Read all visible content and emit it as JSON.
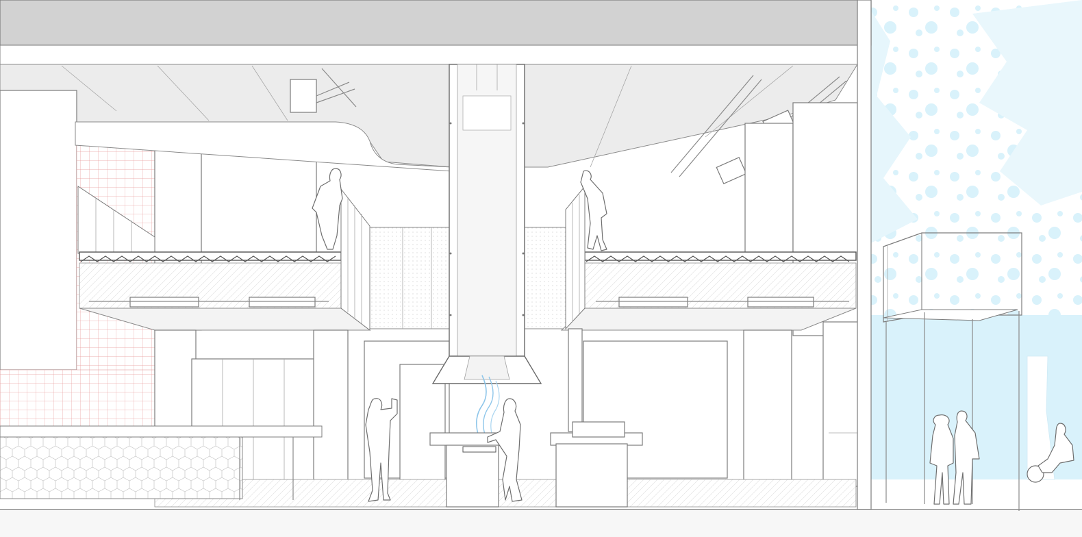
{
  "drawing": {
    "type": "architectural-section-perspective",
    "colors": {
      "background": "#ffffff",
      "roof_slab": "#d2d2d2",
      "ceiling": "#ececec",
      "linework": "#8a8a8a",
      "grid_tile_accent": "#e99a9a",
      "exterior_sky": "#d9f2fb",
      "exhaust_smoke": "#8ec6ea"
    },
    "elements": [
      {
        "name": "roof-slab"
      },
      {
        "name": "ceiling-beams"
      },
      {
        "name": "left-mezzanine"
      },
      {
        "name": "right-mezzanine"
      },
      {
        "name": "central-exhaust-hood"
      },
      {
        "name": "red-grid-tile-wall"
      },
      {
        "name": "hexagon-tile-counter"
      },
      {
        "name": "kitchen-island"
      },
      {
        "name": "exterior-canopy-frame"
      },
      {
        "name": "exterior-tree"
      }
    ],
    "figures": [
      {
        "name": "woman-on-left-mezzanine"
      },
      {
        "name": "woman-on-right-mezzanine"
      },
      {
        "name": "person-taking-photo"
      },
      {
        "name": "cook-at-grill"
      },
      {
        "name": "couple-outside"
      },
      {
        "name": "motorcyclist-outside"
      }
    ]
  }
}
